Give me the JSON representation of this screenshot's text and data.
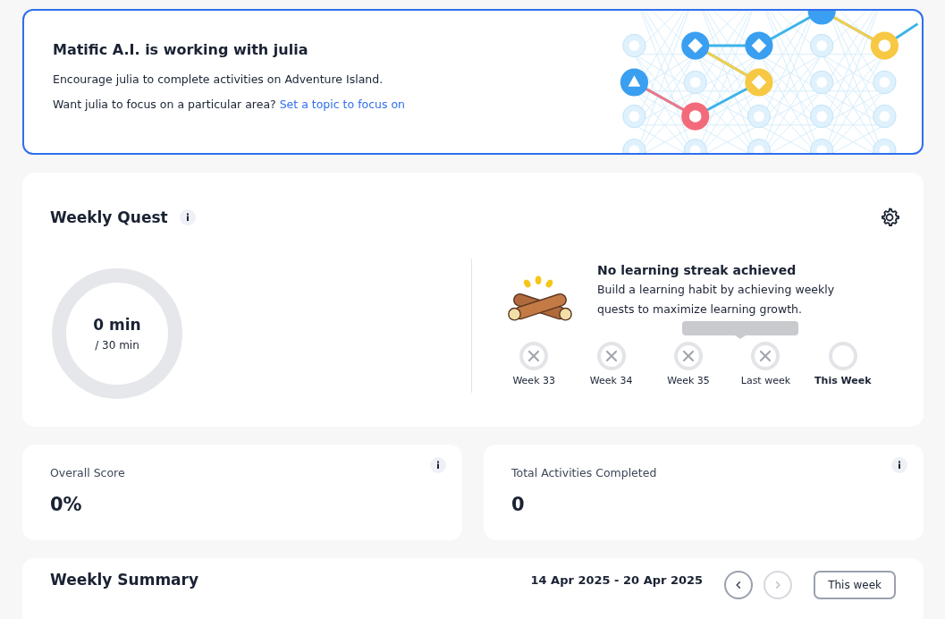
{
  "banner": {
    "title": "Matific A.I. is working with julia",
    "line_1": "Encourage julia to complete activities on Adventure Island.",
    "line_2": "Want julia to focus on a particular area?",
    "link": "Set a topic to focus on"
  },
  "weekly_quest": {
    "title": "Weekly Quest",
    "progress": {
      "value": "0 min",
      "target": "/ 30 min"
    },
    "streak": {
      "title": "No learning streak achieved",
      "text": "Build a learning habit by achieving weekly quests to maximize learning growth."
    },
    "weeks": [
      {
        "label": "Week 33",
        "missed": true,
        "current": false
      },
      {
        "label": "Week 34",
        "missed": true,
        "current": false
      },
      {
        "label": "Week 35",
        "missed": true,
        "current": false
      },
      {
        "label": "Last week",
        "missed": true,
        "current": false
      },
      {
        "label": "This Week",
        "missed": false,
        "current": true
      }
    ]
  },
  "stats": [
    {
      "label": "Overall Score",
      "value": "0%"
    },
    {
      "label": "Total Activities Completed",
      "value": "0"
    }
  ],
  "weekly_summary": {
    "title": "Weekly Summary",
    "date_range": "14 Apr 2025 - 20 Apr 2025",
    "prev_enabled": true,
    "next_enabled": false,
    "this_week_button": "This week"
  }
}
